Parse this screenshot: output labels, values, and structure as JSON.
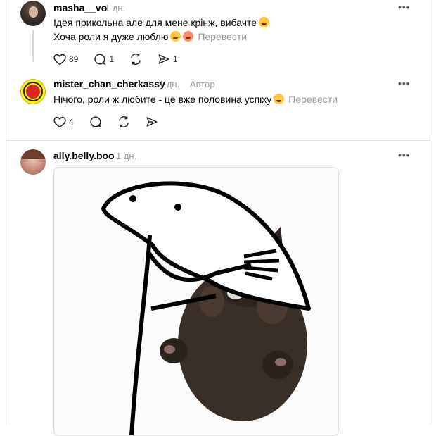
{
  "comments": [
    {
      "username": "masha__vo",
      "time": "1 дн.",
      "lines": [
        "Ідея прикольна але для мене крінж, вибачте",
        "Хоча роли я дуже люблю"
      ],
      "translate": "Перевести",
      "likes": "89",
      "replies": "1",
      "reposts": "",
      "shares": "1"
    },
    {
      "username": "mister_chan_cherkassy",
      "time": "1 дн.",
      "author_badge": "Автор",
      "lines": [
        "Нічого, роли ж любите - це вже половина успіху"
      ],
      "translate": "Перевести",
      "likes": "4"
    },
    {
      "username": "ally.belly.boo",
      "time": "1 дн."
    }
  ],
  "more_label": "•••",
  "icons": [
    "heart-icon",
    "comment-icon",
    "repost-icon",
    "share-icon",
    "more-icon"
  ]
}
